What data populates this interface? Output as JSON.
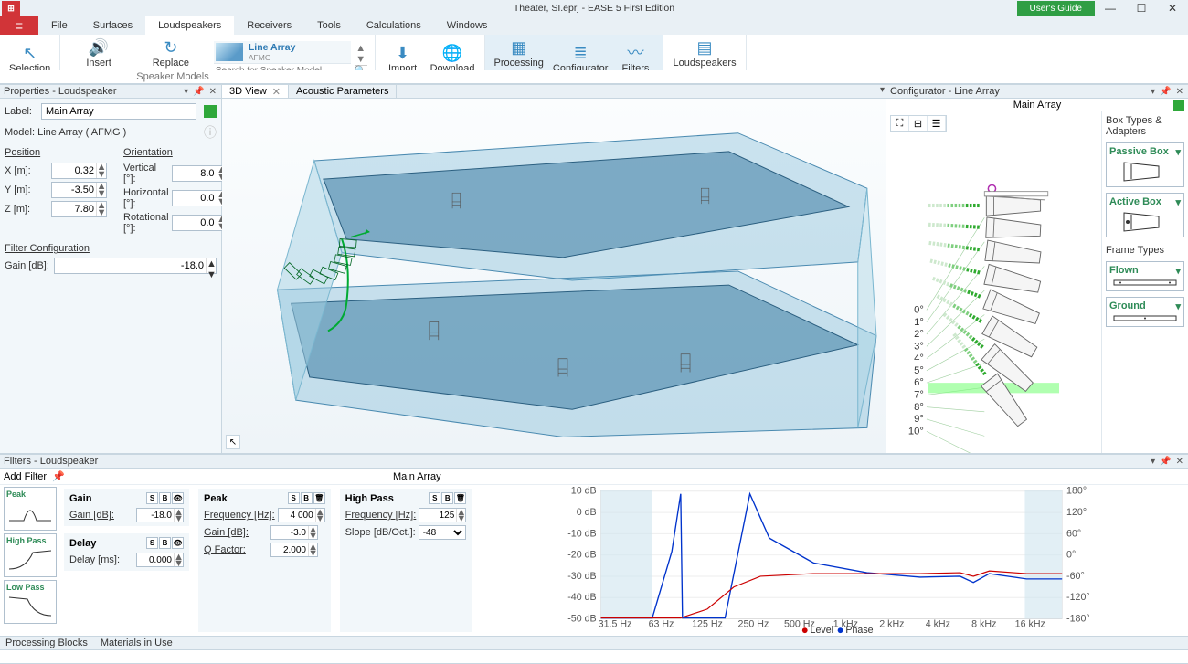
{
  "titlebar": {
    "title": "Theater, SI.eprj - EASE 5 First Edition",
    "guide": "User's Guide"
  },
  "menu": {
    "items": [
      "File",
      "Surfaces",
      "Loudspeakers",
      "Receivers",
      "Tools",
      "Calculations",
      "Windows"
    ],
    "active": 2
  },
  "ribbon": {
    "selection": "Selection",
    "insert": "Insert\nLoudspeaker",
    "replace": "Replace\nSpeaker Model",
    "line_array": "Line Array",
    "line_array_sub": "AFMG",
    "search_ph": "Search for Speaker Model",
    "import": "Import",
    "download": "Download",
    "processing": "Processing\nBlocks",
    "configurator": "Configurator",
    "filters": "Filters",
    "lstable": "Loudspeakers\nTable",
    "sec_speaker_models": "Speaker Models"
  },
  "props": {
    "header": "Properties - Loudspeaker",
    "label_lbl": "Label:",
    "label_val": "Main Array",
    "model_lbl": "Model:",
    "model_val": "Line Array ( AFMG )",
    "position": "Position",
    "orientation": "Orientation",
    "x_lbl": "X [m]:",
    "x_val": "0.32",
    "y_lbl": "Y [m]:",
    "y_val": "-3.50",
    "z_lbl": "Z [m]:",
    "z_val": "7.80",
    "v_lbl": "Vertical [°]:",
    "v_val": "8.0",
    "h_lbl": "Horizontal [°]:",
    "h_val": "0.0",
    "r_lbl": "Rotational [°]:",
    "r_val": "0.0",
    "filter_config": "Filter Configuration",
    "gain_lbl": "Gain [dB]:",
    "gain_val": "-18.0"
  },
  "tabs": {
    "t1": "3D View",
    "t2": "Acoustic Parameters"
  },
  "config": {
    "header": "Configurator - Line Array",
    "title": "Main Array",
    "side_header": "Box Types & Adapters",
    "passive": "Passive Box",
    "active": "Active Box",
    "frame_header": "Frame Types",
    "flown": "Flown",
    "ground": "Ground",
    "angles": [
      "0°",
      "1°",
      "2°",
      "3°",
      "4°",
      "5°",
      "6°",
      "7°",
      "8°",
      "9°",
      "10°"
    ]
  },
  "filters": {
    "header": "Filters - Loudspeaker",
    "add": "Add Filter",
    "title": "Main Array",
    "types": [
      "Peak",
      "High Pass",
      "Low Pass"
    ],
    "gain": {
      "h": "Gain",
      "lbl": "Gain [dB]:",
      "val": "-18.0"
    },
    "delay": {
      "h": "Delay",
      "lbl": "Delay [ms]:",
      "val": "0.000"
    },
    "peak": {
      "h": "Peak",
      "f_lbl": "Frequency [Hz]:",
      "f": "4 000",
      "g_lbl": "Gain [dB]:",
      "g": "-3.0",
      "q_lbl": "Q Factor:",
      "q": "2.000"
    },
    "hp": {
      "h": "High Pass",
      "f_lbl": "Frequency [Hz]:",
      "f": "125",
      "s_lbl": "Slope [dB/Oct.]:",
      "s": "-48"
    },
    "legend": {
      "level": "Level",
      "phase": "Phase"
    }
  },
  "status": {
    "pb": "Processing Blocks",
    "mat": "Materials in Use"
  },
  "chart_data": {
    "type": "line",
    "x_ticks": [
      "31.5 Hz",
      "63 Hz",
      "125 Hz",
      "250 Hz",
      "500 Hz",
      "1 kHz",
      "2 kHz",
      "4 kHz",
      "8 kHz",
      "16 kHz"
    ],
    "y_left": {
      "label": "dB",
      "ticks": [
        10,
        0,
        -10,
        -20,
        -30,
        -40,
        -50
      ]
    },
    "y_right": {
      "label": "deg",
      "ticks": [
        180,
        120,
        60,
        0,
        -60,
        -120,
        -180
      ]
    },
    "series": [
      {
        "name": "Level",
        "color": "#0033cc",
        "values": [
          -50,
          -50,
          -28,
          10,
          -50,
          10,
          -6,
          -14,
          -17,
          -18,
          -19,
          -20,
          -18,
          -18
        ]
      },
      {
        "name": "Phase",
        "color": "#cc0000",
        "values": [
          -50,
          -50,
          -50,
          -50,
          -40,
          -20,
          -18,
          -18,
          -18,
          -18,
          -19,
          -17,
          -18,
          -18
        ]
      }
    ]
  }
}
